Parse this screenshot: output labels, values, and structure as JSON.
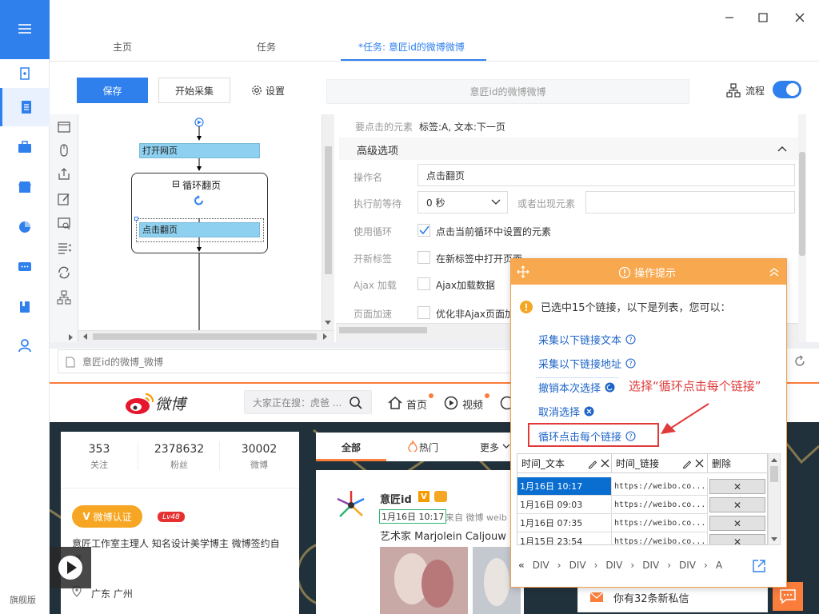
{
  "window": {
    "minimize": "—",
    "maximize": "☐",
    "close": "✕"
  },
  "sidebar": {
    "version_label": "旗舰版"
  },
  "tabs": [
    {
      "label": "主页"
    },
    {
      "label": "任务"
    },
    {
      "label": "*任务: 意匠id的微博微博"
    }
  ],
  "toolbar": {
    "save_label": "保存",
    "start_label": "开始采集",
    "settings_label": "设置",
    "task_name": "意匠id的微博微博",
    "flow_label": "流程"
  },
  "flow": {
    "open_page": "打开网页",
    "loop_title": "循环翻页",
    "loop_collapse": "⊟",
    "click_page": "点击翻页"
  },
  "settings": {
    "element_label": "要点击的元素",
    "element_value": "标签:A, 文本:下一页",
    "advanced_label": "高级选项",
    "op_name_label": "操作名",
    "op_name_value": "点击翻页",
    "wait_label": "执行前等待",
    "wait_value": "0 秒",
    "or_appear_label": "或者出现元素",
    "use_loop_label": "使用循环",
    "use_loop_text": "点击当前循环中设置的元素",
    "new_tab_label": "开新标签",
    "new_tab_text": "在新标签中打开页面",
    "ajax_label": "Ajax 加载",
    "ajax_text": "Ajax加载数据",
    "speedup_label": "页面加速",
    "speedup_text": "优化非Ajax页面加"
  },
  "browser": {
    "url": "意匠id的微博_微博"
  },
  "weibo": {
    "logo_text": "微博",
    "search_placeholder": "大家正在搜：虎爸 ...",
    "nav_home": "首页",
    "nav_video": "视频",
    "stats": [
      {
        "num": "353",
        "label": "关注"
      },
      {
        "num": "2378632",
        "label": "粉丝"
      },
      {
        "num": "30002",
        "label": "微博"
      }
    ],
    "verify_label": "微博认证",
    "level": "Lv48",
    "bio": "意匠工作室主理人 知名设计美学博主 微博签约自",
    "bio_line2": "媒",
    "location": "广东 广州",
    "feed_tabs": {
      "all": "全部",
      "hot": "热门",
      "more": "更多"
    },
    "post_author": "意匠id",
    "post_time": "1月16日 10:17",
    "post_source": "来自 微博 weib",
    "post_text": "艺术家 Marjolein Caljouw 纟",
    "messages": "你有32条新私信"
  },
  "tip": {
    "title": "操作提示",
    "summary": "已选中15个链接，以下是列表，您可以：",
    "links": [
      "采集以下链接文本",
      "采集以下链接地址",
      "撤销本次选择",
      "取消选择",
      "循环点击每个链接"
    ],
    "annotation": "选择“循环点击每个链接”",
    "columns": [
      "时间_文本",
      "时间_链接",
      "删除"
    ],
    "rows": [
      {
        "text": "1月16日 10:17",
        "link": "https://weibo.co..."
      },
      {
        "text": "1月16日 09:03",
        "link": "https://weibo.co..."
      },
      {
        "text": "1月16日 07:35",
        "link": "https://weibo.co..."
      },
      {
        "text": "1月15日 23:54",
        "link": "https://weibo.co..."
      }
    ],
    "delete_glyph": "✕",
    "path": [
      "«",
      "DIV",
      "›",
      "DIV",
      "›",
      "DIV",
      "›",
      "DIV",
      "›",
      "DIV",
      "›",
      "A"
    ]
  },
  "colors": {
    "accent": "#2f80ed",
    "tip_header": "#f8a94f",
    "annotation": "#e03a3a",
    "weibo_orange": "#fa7d3c"
  }
}
